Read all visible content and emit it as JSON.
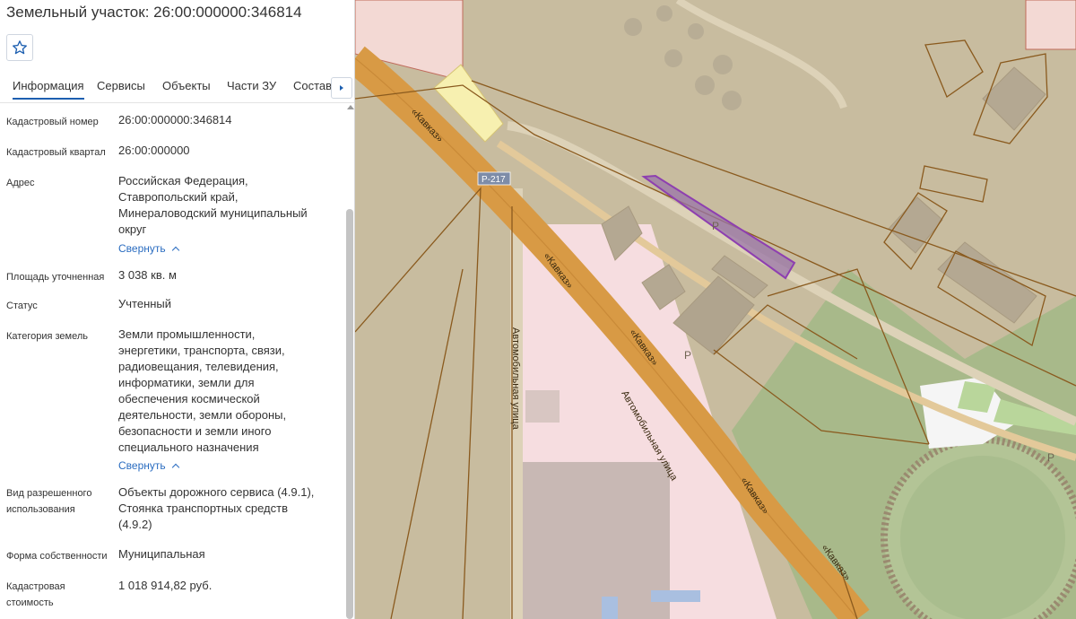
{
  "title": "Земельный участок: 26:00:000000:346814",
  "tabs": [
    "Информация",
    "Сервисы",
    "Объекты",
    "Части ЗУ",
    "Состав"
  ],
  "fields": {
    "cadastral_number": {
      "label": "Кадастровый номер",
      "value": "26:00:000000:346814"
    },
    "cadastral_quarter": {
      "label": "Кадастровый квартал",
      "value": "26:00:000000"
    },
    "address": {
      "label": "Адрес",
      "value": [
        "Российская Федерация,",
        "Ставропольский край,",
        "Минераловодский муниципальный",
        "округ"
      ],
      "collapse": "Свернуть"
    },
    "area": {
      "label": "Площадь уточненная",
      "value": "3 038 кв. м"
    },
    "status": {
      "label": "Статус",
      "value": "Учтенный"
    },
    "land_category": {
      "label": "Категория земель",
      "value": [
        "Земли промышленности,",
        "энергетики, транспорта, связи,",
        "радиовещания, телевидения,",
        "информатики, земли для",
        "обеспечения космической",
        "деятельности, земли обороны,",
        "безопасности и земли иного",
        "специального назначения"
      ],
      "collapse": "Свернуть"
    },
    "permitted_use": {
      "label": [
        "Вид разрешенного",
        "использования"
      ],
      "value": [
        "Объекты дорожного сервиса (4.9.1),",
        "Стоянка транспортных средств",
        "(4.9.2)"
      ]
    },
    "ownership": {
      "label": "Форма собственности",
      "value": "Муниципальная"
    },
    "cadastral_value": {
      "label": [
        "Кадастровая",
        "стоимость"
      ],
      "value": "1 018 914,82 руб."
    }
  },
  "map": {
    "road_labels": [
      "«Кавказ»",
      "«Кавказ»",
      "«Кавказ»",
      "«Кавказ»",
      "«Кавказ»"
    ],
    "route_shield": "Р-217",
    "street_labels": [
      "Автомобильная улица",
      "Автомобильная улица"
    ],
    "parking_labels": [
      "P",
      "P",
      "P"
    ]
  },
  "colors": {
    "highlight_parcel": "#8e3fb0",
    "road": "#d89a45",
    "parcel_border": "#8a5a1e",
    "accent": "#1d5fb0"
  }
}
